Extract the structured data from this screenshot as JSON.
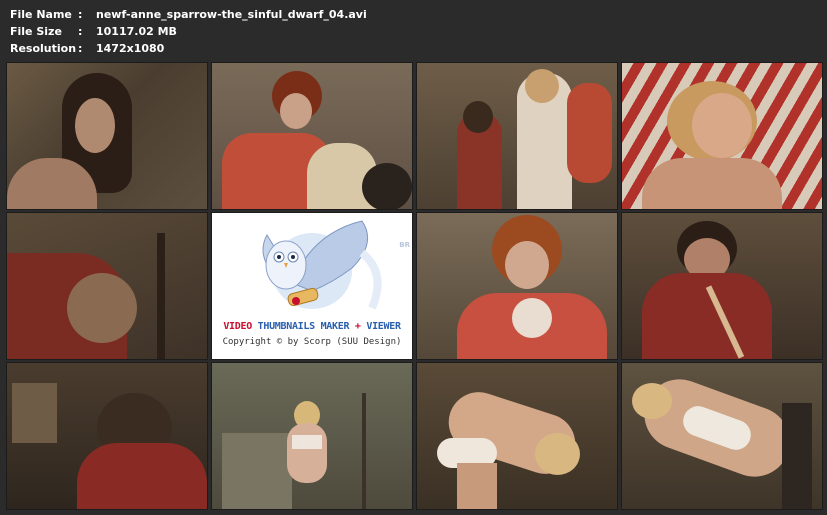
{
  "info": {
    "file_name_label": "File Name",
    "file_name": "newf-anne_sparrow-the_sinful_dwarf_04.avi",
    "file_size_label": "File Size",
    "file_size": "10117.02 MB",
    "resolution_label": "Resolution",
    "resolution": "1472x1080",
    "separator": ":"
  },
  "logo": {
    "brand_part1": "VIDEO ",
    "brand_part2": "THUMBNAILS MAKER",
    "brand_part3": " + ",
    "brand_part4": "VIEWER",
    "copyright": "Copyright © by Scorp (SUU Design)",
    "side_text": "BR"
  },
  "colors": {
    "background": "#2b2b2b",
    "info_text": "#ffffff",
    "logo_red": "#c8102e",
    "logo_blue": "#2a5fb0"
  }
}
